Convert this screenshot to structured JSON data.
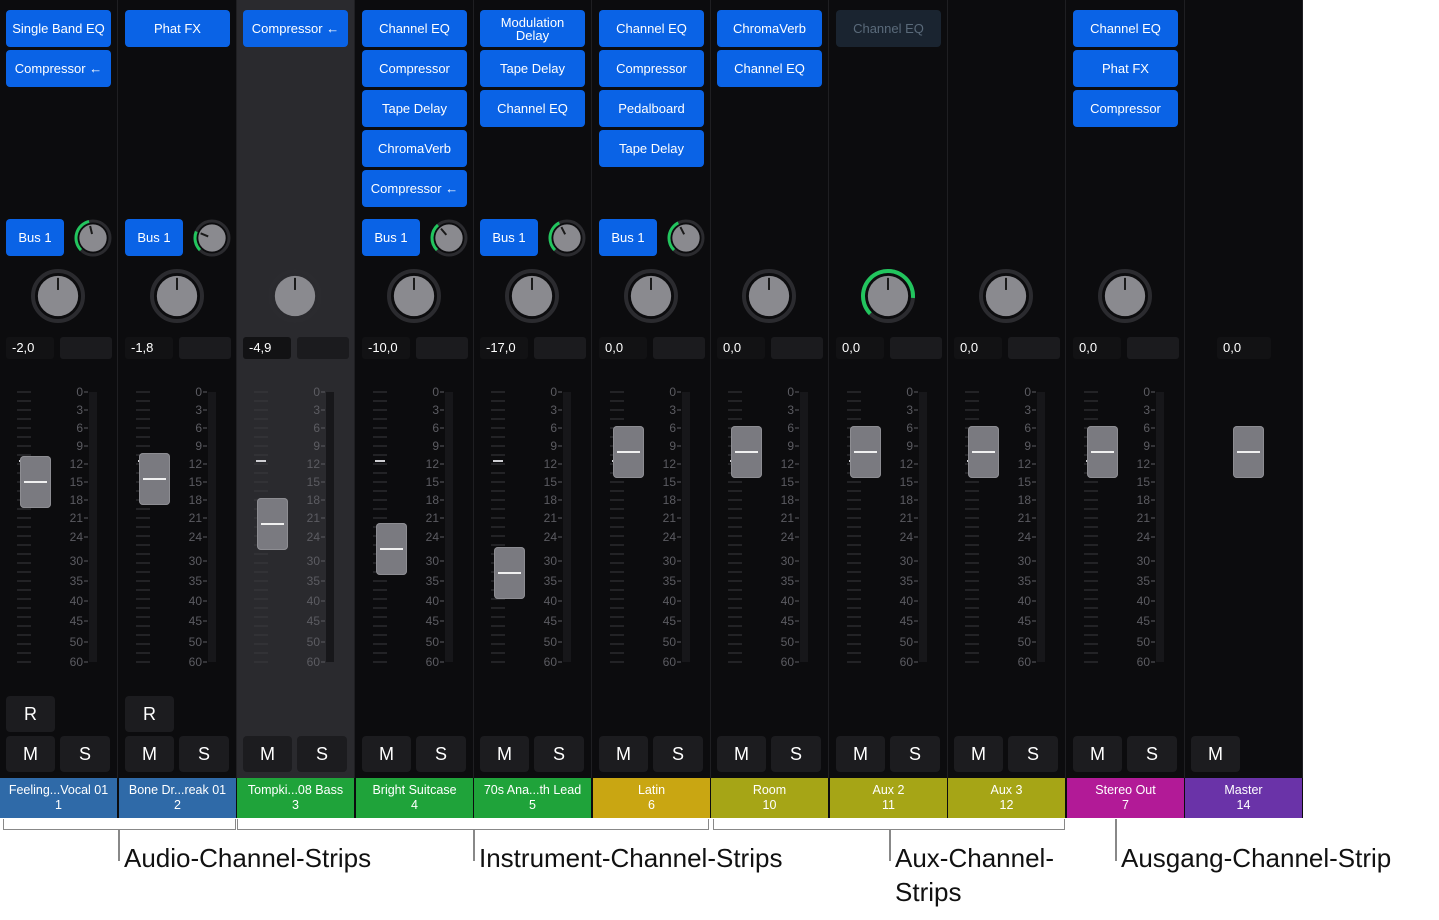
{
  "strips": [
    {
      "plugins": [
        "Single Band EQ",
        "Compressor ←"
      ],
      "bus": "Bus 1",
      "send": 0.45,
      "pan": 0,
      "volume": "-2,0",
      "fader_db": -15,
      "rec": "R",
      "mute": "M",
      "solo": "S",
      "name": "Feeling...Vocal 01",
      "number": "1",
      "color": "#2f6aa8",
      "selected": false
    },
    {
      "plugins": [
        "Phat FX"
      ],
      "bus": "Bus 1",
      "send": 0.25,
      "pan": 0,
      "volume": "-1,8",
      "fader_db": -14.5,
      "rec": "R",
      "mute": "M",
      "solo": "S",
      "name": "Bone Dr...reak 01",
      "number": "2",
      "color": "#2f6aa8",
      "selected": false
    },
    {
      "plugins": [
        "Compressor ←"
      ],
      "bus": null,
      "send": null,
      "pan": 0,
      "volume": "-4,9",
      "fader_db": -22,
      "rec": null,
      "mute": "M",
      "solo": "S",
      "name": "Tompki...08 Bass",
      "number": "3",
      "color": "#1fa33a",
      "selected": true
    },
    {
      "plugins": [
        "Channel EQ",
        "Compressor",
        "Tape Delay",
        "ChromaVerb",
        "Compressor ←"
      ],
      "bus": "Bus 1",
      "send": 0.35,
      "pan": 0,
      "volume": "-10,0",
      "fader_db": -27,
      "rec": null,
      "mute": "M",
      "solo": "S",
      "name": "Bright Suitcase",
      "number": "4",
      "color": "#1fa33a",
      "selected": false
    },
    {
      "plugins": [
        "Modulation Delay",
        "Tape Delay",
        "Channel EQ"
      ],
      "bus": "Bus 1",
      "send": 0.4,
      "pan": 0,
      "volume": "-17,0",
      "fader_db": -33,
      "rec": null,
      "mute": "M",
      "solo": "S",
      "name": "70s Ana...th Lead",
      "number": "5",
      "color": "#1fa33a",
      "selected": false
    },
    {
      "plugins": [
        "Channel EQ",
        "Compressor",
        "Pedalboard",
        "Tape Delay"
      ],
      "bus": "Bus 1",
      "send": 0.4,
      "pan": 0,
      "volume": "0,0",
      "fader_db": -10,
      "rec": null,
      "mute": "M",
      "solo": "S",
      "name": "Latin",
      "number": "6",
      "color": "#c9a612",
      "selected": false
    },
    {
      "plugins": [
        "ChromaVerb",
        "Channel EQ"
      ],
      "bus": null,
      "send": null,
      "pan": 0,
      "volume": "0,0",
      "fader_db": -10,
      "rec": null,
      "mute": "M",
      "solo": "S",
      "name": "Room",
      "number": "10",
      "color": "#a6a516",
      "selected": false
    },
    {
      "plugins": [
        "Channel EQ"
      ],
      "plugins_dim": true,
      "bus": null,
      "send": null,
      "pan": 0.85,
      "volume": "0,0",
      "fader_db": -10,
      "rec": null,
      "mute": "M",
      "solo": "S",
      "name": "Aux 2",
      "number": "11",
      "color": "#a6a516",
      "selected": false
    },
    {
      "plugins": [],
      "bus": null,
      "send": null,
      "pan": 0,
      "volume": "0,0",
      "fader_db": -10,
      "rec": null,
      "mute": "M",
      "solo": "S",
      "name": "Aux 3",
      "number": "12",
      "color": "#a6a516",
      "selected": false
    },
    {
      "plugins": [
        "Channel EQ",
        "Phat FX",
        "Compressor"
      ],
      "bus": null,
      "send": null,
      "pan": 0,
      "volume": "0,0",
      "fader_db": -10,
      "rec": null,
      "mute": "M",
      "solo": "S",
      "name": "Stereo Out",
      "number": "7",
      "color": "#b21a97",
      "selected": false
    },
    {
      "plugins": [],
      "bus": null,
      "send": null,
      "pan": null,
      "volume": "0,0",
      "fader_db": -10,
      "rec": null,
      "mute": "M",
      "solo": null,
      "name": "Master",
      "number": "14",
      "color": "#6a33a8",
      "selected": false,
      "master": true
    }
  ],
  "scale_labels": [
    "0",
    "3",
    "6",
    "9",
    "12",
    "15",
    "18",
    "21",
    "24",
    "30",
    "35",
    "40",
    "45",
    "50",
    "60"
  ],
  "annotations": {
    "audio": "Audio-Channel-Strips",
    "instrument": "Instrument-Channel-Strips",
    "aux": "Aux-Channel-\nStrips",
    "output": "Ausgang-Channel-Strip"
  },
  "colors": {
    "plugin_blue": "#0a63e6",
    "send_ring": "#22c55e"
  }
}
